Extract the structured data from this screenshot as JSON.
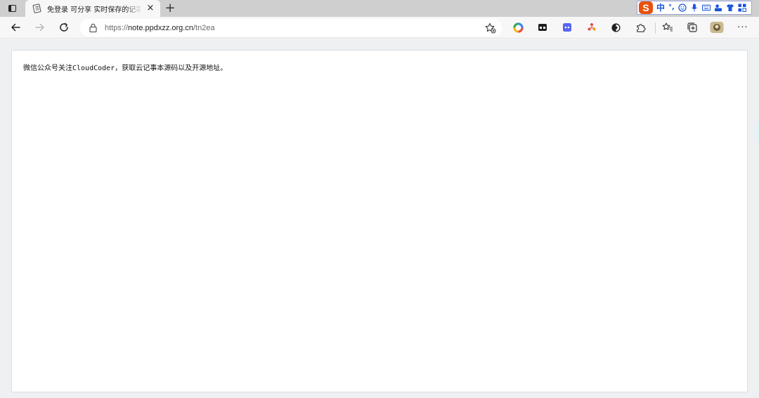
{
  "browser": {
    "tab": {
      "title": "免登录 可分享 实时保存的记事本",
      "close_glyph": "×",
      "favicon": "notepad-icon"
    },
    "new_tab_glyph": "+",
    "address": {
      "scheme": "https://",
      "host": "note.ppdxzz.org.cn",
      "path": "/tn2ea"
    },
    "ime_toolbar": {
      "logo": "S",
      "mode": "中",
      "punct": "°,",
      "icons": [
        "smiley-icon",
        "microphone-icon",
        "keyboard-icon",
        "user-tools-icon",
        "shirt-icon",
        "grid-icon"
      ]
    },
    "toolbar_icons": [
      "back-icon",
      "forward-icon",
      "refresh-icon",
      "lock-icon",
      "favorite-add-icon",
      "extension-colorwheel-icon",
      "extension-dark-icon",
      "extension-discord-icon",
      "extension-tree-icon",
      "extension-circle-icon",
      "extensions-puzzle-icon",
      "favorites-icon",
      "collections-icon",
      "profile-avatar-icon",
      "more-icon"
    ],
    "more_glyph": "···"
  },
  "page": {
    "note_text": "微信公众号关注CloudCoder，获取云记事本源码以及开源地址。"
  },
  "colors": {
    "accent_ime": "#1a56db",
    "ime_logo": "#e8520f",
    "page_background": "#eef0f2"
  }
}
